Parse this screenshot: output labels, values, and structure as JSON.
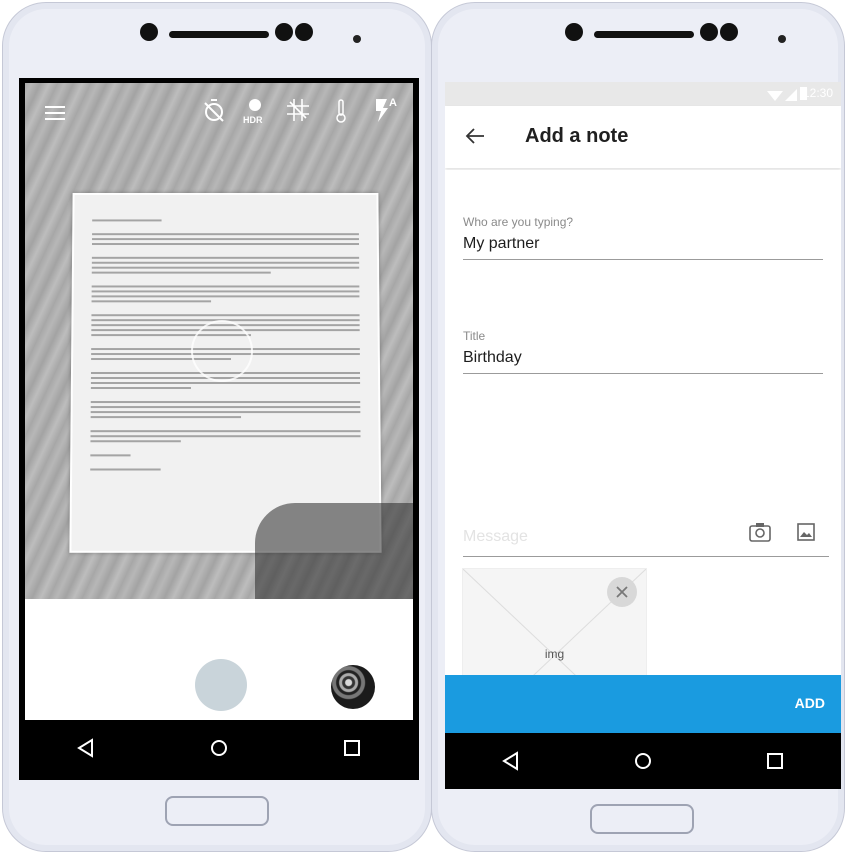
{
  "left_phone": {
    "camera_toolbar": {
      "menu_icon": "hamburger-menu-icon",
      "timer_icon": "timer-off-icon",
      "hdr_label": "HDR",
      "grid_icon": "grid-icon",
      "white_balance_icon": "thermometer-icon",
      "flash_label": "A"
    },
    "navigation": [
      "back",
      "home",
      "recents"
    ]
  },
  "right_phone": {
    "status_bar": {
      "time": "12:30"
    },
    "app_bar": {
      "title": "Add a note",
      "back_icon": "arrow-back-icon"
    },
    "form": {
      "who": {
        "label": "Who are you typing?",
        "value": "My partner"
      },
      "title": {
        "label": "Title",
        "value": "Birthday"
      },
      "message": {
        "placeholder": "Message"
      }
    },
    "attachment": {
      "label": "img"
    },
    "action": {
      "label": "ADD"
    },
    "colors": {
      "accent": "#1a9be0"
    }
  }
}
